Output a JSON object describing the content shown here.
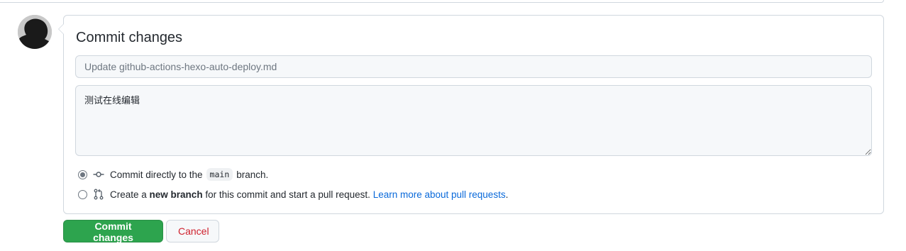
{
  "form": {
    "title": "Commit changes",
    "summary_placeholder": "Update github-actions-hexo-auto-deploy.md",
    "summary_value": "",
    "description_value": "测试在线编辑"
  },
  "options": {
    "direct": {
      "prefix": "Commit directly to the",
      "branch": "main",
      "suffix": "branch.",
      "selected": true,
      "icon": "git-commit-icon"
    },
    "new_branch": {
      "prefix": "Create a",
      "bold": "new branch",
      "middle": "for this commit and start a pull request.",
      "link": "Learn more about pull requests",
      "end": ".",
      "selected": false,
      "icon": "git-pull-request-icon"
    }
  },
  "buttons": {
    "commit": "Commit changes",
    "cancel": "Cancel"
  },
  "colors": {
    "primary": "#2da44e",
    "danger": "#cf222e",
    "link": "#0969da"
  }
}
